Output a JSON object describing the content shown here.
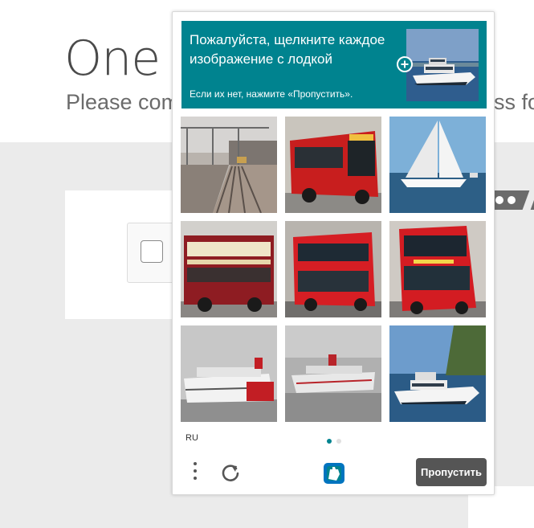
{
  "background_page": {
    "title": "One m",
    "subtitle": "Please com",
    "subtitle_tail": "ss fo"
  },
  "challenge": {
    "prompt_text": "Пожалуйста, щелкните каждое изображение с лодкой",
    "prompt_subtext": "Если их нет, нажмите «Пропустить».",
    "prompt_image": "boat",
    "tiles": [
      {
        "subject": "railway tracks"
      },
      {
        "subject": "red bus"
      },
      {
        "subject": "sailboat"
      },
      {
        "subject": "double-decker bus"
      },
      {
        "subject": "double-decker bus"
      },
      {
        "subject": "double-decker bus"
      },
      {
        "subject": "cruise ship"
      },
      {
        "subject": "cruise ship"
      },
      {
        "subject": "boat"
      }
    ],
    "language": "RU",
    "pager": {
      "current": 1,
      "total": 2
    },
    "skip_button_label": "Пропустить",
    "icons": [
      "menu-dots-icon",
      "refresh-icon",
      "hcaptcha-logo-icon"
    ],
    "colors": {
      "accent": "#00838f",
      "skip_button": "#555555"
    }
  }
}
